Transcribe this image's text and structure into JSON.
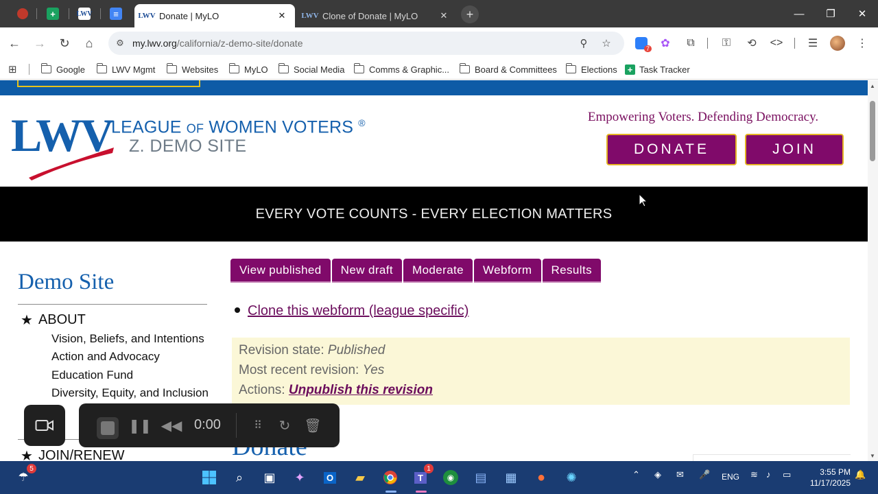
{
  "browser": {
    "tabs": [
      {
        "title": "Donate | MyLO",
        "active": true
      },
      {
        "title": "Clone of Donate | MyLO",
        "active": false
      }
    ],
    "url_host": "my.lwv.org",
    "url_path": "/california/z-demo-site/donate",
    "extension_badge": "7",
    "bookmarks": [
      {
        "label": "Google",
        "icon": "folder-icon"
      },
      {
        "label": "LWV Mgmt",
        "icon": "folder-icon"
      },
      {
        "label": "Websites",
        "icon": "folder-icon"
      },
      {
        "label": "MyLO",
        "icon": "folder-icon"
      },
      {
        "label": "Social Media",
        "icon": "folder-icon"
      },
      {
        "label": "Comms & Graphic...",
        "icon": "folder-icon"
      },
      {
        "label": "Board & Committees",
        "icon": "folder-icon"
      },
      {
        "label": "Elections",
        "icon": "folder-icon"
      },
      {
        "label": "Task Tracker",
        "icon": "sheets-icon"
      }
    ]
  },
  "header": {
    "logo_text": "LWV",
    "league_name_1": "LEAGUE",
    "league_name_of": "OF",
    "league_name_2": "WOMEN VOTERS",
    "registered": "®",
    "site_name": "Z. DEMO SITE",
    "tagline": "Empowering Voters. Defending Democracy.",
    "donate_label": "DONATE",
    "join_label": "JOIN"
  },
  "banner": {
    "text": "EVERY VOTE COUNTS - EVERY ELECTION MATTERS"
  },
  "sidebar": {
    "title": "Demo Site",
    "section_about": "ABOUT",
    "about_links": [
      "Vision, Beliefs, and Intentions",
      "Action and Advocacy",
      "Education Fund",
      "Diversity, Equity, and Inclusion"
    ],
    "section_join": "JOIN/RENEW"
  },
  "main": {
    "tabs": [
      "View published",
      "New draft",
      "Moderate",
      "Webform",
      "Results"
    ],
    "clone_link": "Clone this webform (league specific)",
    "revision_state_label": "Revision state:",
    "revision_state_value": "Published",
    "recent_label": "Most recent revision:",
    "recent_value": "Yes",
    "actions_label": "Actions:",
    "actions_link": "Unpublish this revision",
    "page_heading": "Donate"
  },
  "recorder": {
    "time": "0:00"
  },
  "taskbar": {
    "language": "ENG",
    "time": "3:55 PM",
    "date": "11/17/2025",
    "notification_count": "5",
    "teams_badge": "1"
  },
  "colors": {
    "lwv_blue": "#1560ad",
    "lwv_purple": "#800a6a",
    "gold_border": "#e4b322",
    "lwv_red": "#c8102e"
  }
}
